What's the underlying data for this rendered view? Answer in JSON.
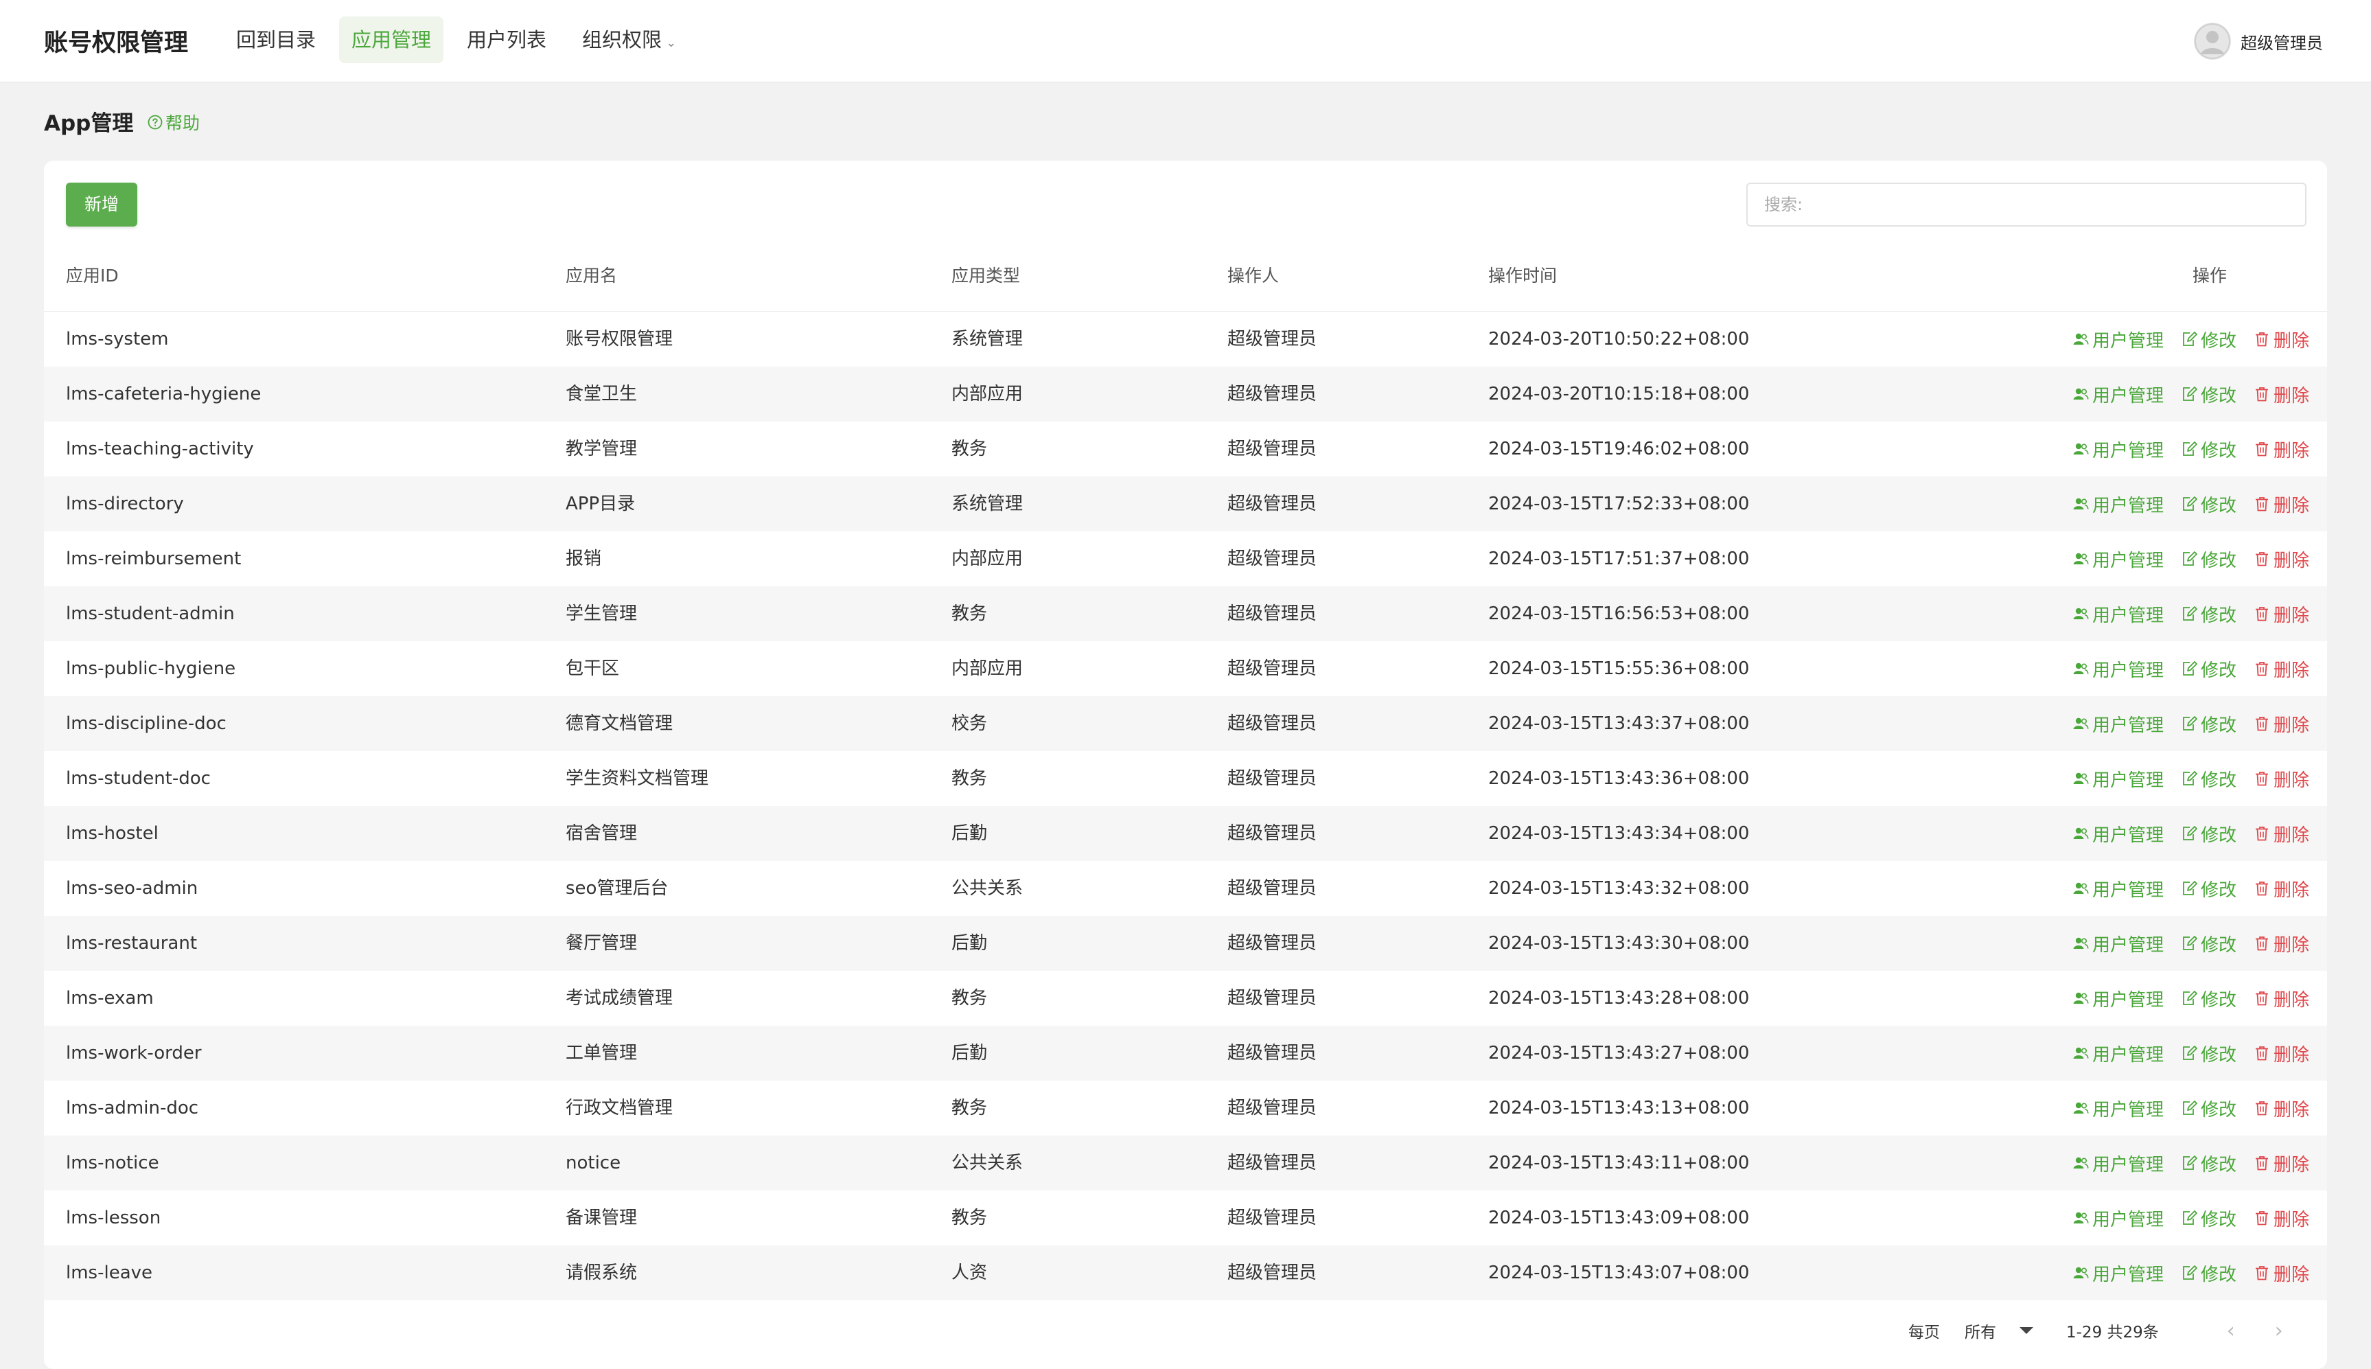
{
  "header": {
    "app_title": "账号权限管理",
    "nav": [
      {
        "label": "回到目录",
        "active": false
      },
      {
        "label": "应用管理",
        "active": true
      },
      {
        "label": "用户列表",
        "active": false
      },
      {
        "label": "组织权限",
        "active": false,
        "has_dropdown": true
      }
    ],
    "user_name": "超级管理员"
  },
  "page": {
    "title": "App管理",
    "help_label": "帮助"
  },
  "toolbar": {
    "add_label": "新增",
    "search_placeholder": "搜索:"
  },
  "table": {
    "columns": [
      "应用ID",
      "应用名",
      "应用类型",
      "操作人",
      "操作时间",
      "操作"
    ],
    "action_labels": {
      "users": "用户管理",
      "edit": "修改",
      "delete": "删除"
    },
    "rows": [
      {
        "id": "lms-system",
        "name": "账号权限管理",
        "type": "系统管理",
        "operator": "超级管理员",
        "time": "2024-03-20T10:50:22+08:00"
      },
      {
        "id": "lms-cafeteria-hygiene",
        "name": "食堂卫生",
        "type": "内部应用",
        "operator": "超级管理员",
        "time": "2024-03-20T10:15:18+08:00"
      },
      {
        "id": "lms-teaching-activity",
        "name": "教学管理",
        "type": "教务",
        "operator": "超级管理员",
        "time": "2024-03-15T19:46:02+08:00"
      },
      {
        "id": "lms-directory",
        "name": "APP目录",
        "type": "系统管理",
        "operator": "超级管理员",
        "time": "2024-03-15T17:52:33+08:00"
      },
      {
        "id": "lms-reimbursement",
        "name": "报销",
        "type": "内部应用",
        "operator": "超级管理员",
        "time": "2024-03-15T17:51:37+08:00"
      },
      {
        "id": "lms-student-admin",
        "name": "学生管理",
        "type": "教务",
        "operator": "超级管理员",
        "time": "2024-03-15T16:56:53+08:00"
      },
      {
        "id": "lms-public-hygiene",
        "name": "包干区",
        "type": "内部应用",
        "operator": "超级管理员",
        "time": "2024-03-15T15:55:36+08:00"
      },
      {
        "id": "lms-discipline-doc",
        "name": "德育文档管理",
        "type": "校务",
        "operator": "超级管理员",
        "time": "2024-03-15T13:43:37+08:00"
      },
      {
        "id": "lms-student-doc",
        "name": "学生资料文档管理",
        "type": "教务",
        "operator": "超级管理员",
        "time": "2024-03-15T13:43:36+08:00"
      },
      {
        "id": "lms-hostel",
        "name": "宿舍管理",
        "type": "后勤",
        "operator": "超级管理员",
        "time": "2024-03-15T13:43:34+08:00"
      },
      {
        "id": "lms-seo-admin",
        "name": "seo管理后台",
        "type": "公共关系",
        "operator": "超级管理员",
        "time": "2024-03-15T13:43:32+08:00"
      },
      {
        "id": "lms-restaurant",
        "name": "餐厅管理",
        "type": "后勤",
        "operator": "超级管理员",
        "time": "2024-03-15T13:43:30+08:00"
      },
      {
        "id": "lms-exam",
        "name": "考试成绩管理",
        "type": "教务",
        "operator": "超级管理员",
        "time": "2024-03-15T13:43:28+08:00"
      },
      {
        "id": "lms-work-order",
        "name": "工单管理",
        "type": "后勤",
        "operator": "超级管理员",
        "time": "2024-03-15T13:43:27+08:00"
      },
      {
        "id": "lms-admin-doc",
        "name": "行政文档管理",
        "type": "教务",
        "operator": "超级管理员",
        "time": "2024-03-15T13:43:13+08:00"
      },
      {
        "id": "lms-notice",
        "name": "notice",
        "type": "公共关系",
        "operator": "超级管理员",
        "time": "2024-03-15T13:43:11+08:00"
      },
      {
        "id": "lms-lesson",
        "name": "备课管理",
        "type": "教务",
        "operator": "超级管理员",
        "time": "2024-03-15T13:43:09+08:00"
      },
      {
        "id": "lms-leave",
        "name": "请假系统",
        "type": "人资",
        "operator": "超级管理员",
        "time": "2024-03-15T13:43:07+08:00"
      }
    ]
  },
  "pagination": {
    "per_page_label": "每页",
    "per_page_value": "所有",
    "range_text": "1-29",
    "total_text": "共29条"
  },
  "colors": {
    "accent": "#4aa73a",
    "primary_button": "#5cad4d",
    "danger": "#e0484c"
  }
}
